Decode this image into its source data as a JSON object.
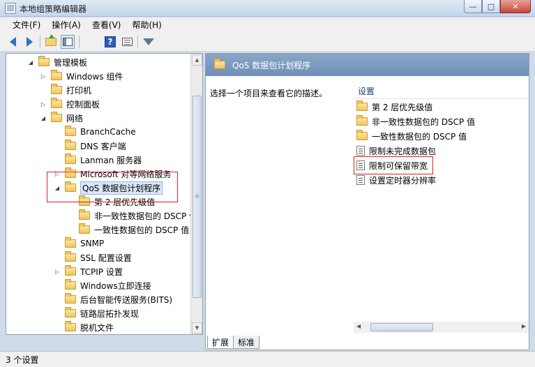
{
  "window": {
    "title": "本地组策略编辑器"
  },
  "menu": {
    "items": [
      "文件(F)",
      "操作(A)",
      "查看(V)",
      "帮助(H)"
    ]
  },
  "toolbar": {
    "icons": [
      "back-icon",
      "forward-icon",
      "up-folder-icon",
      "console-tree-icon",
      "help-icon",
      "properties-icon",
      "filter-icon"
    ]
  },
  "tree": {
    "items": [
      {
        "label": "管理模板",
        "level": 0,
        "toggle": "expanded"
      },
      {
        "label": "Windows 组件",
        "level": 1,
        "toggle": "collapsed"
      },
      {
        "label": "打印机",
        "level": 1,
        "toggle": "none"
      },
      {
        "label": "控制面板",
        "level": 1,
        "toggle": "collapsed"
      },
      {
        "label": "网络",
        "level": 1,
        "toggle": "expanded"
      },
      {
        "label": "BranchCache",
        "level": 2,
        "toggle": "none"
      },
      {
        "label": "DNS 客户端",
        "level": 2,
        "toggle": "none"
      },
      {
        "label": "Lanman 服务器",
        "level": 2,
        "toggle": "none"
      },
      {
        "label": "Microsoft 对等网络服务",
        "level": 2,
        "toggle": "collapsed"
      },
      {
        "label": "QoS 数据包计划程序",
        "level": 2,
        "toggle": "expanded",
        "selected": true
      },
      {
        "label": "第 2 层优先级值",
        "level": 3,
        "toggle": "none"
      },
      {
        "label": "非一致性数据包的 DSCP 值",
        "level": 3,
        "toggle": "none"
      },
      {
        "label": "一致性数据包的 DSCP 值",
        "level": 3,
        "toggle": "none"
      },
      {
        "label": "SNMP",
        "level": 2,
        "toggle": "none"
      },
      {
        "label": "SSL 配置设置",
        "level": 2,
        "toggle": "none"
      },
      {
        "label": "TCPIP 设置",
        "level": 2,
        "toggle": "collapsed"
      },
      {
        "label": "Windows立即连接",
        "level": 2,
        "toggle": "none"
      },
      {
        "label": "后台智能传送服务(BITS)",
        "level": 2,
        "toggle": "none"
      },
      {
        "label": "链路层拓扑发现",
        "level": 2,
        "toggle": "none"
      },
      {
        "label": "脱机文件",
        "level": 2,
        "toggle": "none"
      }
    ]
  },
  "details": {
    "header_title": "QoS 数据包计划程序",
    "description": "选择一个项目来查看它的描述。",
    "column_header": "设置",
    "settings": [
      {
        "label": "第 2 层优先级值",
        "type": "folder"
      },
      {
        "label": "非一致性数据包的 DSCP 值",
        "type": "folder"
      },
      {
        "label": "一致性数据包的 DSCP 值",
        "type": "folder"
      },
      {
        "label": "限制未完成数据包",
        "type": "setting"
      },
      {
        "label": "限制可保留带宽",
        "type": "setting",
        "highlighted": true
      },
      {
        "label": "设置定时器分辨率",
        "type": "setting"
      }
    ],
    "tabs": [
      "扩展",
      "标准"
    ]
  },
  "status": {
    "text": "3 个设置"
  },
  "colors": {
    "highlight": "#d9211e",
    "header_bg": "#7b98bf"
  }
}
